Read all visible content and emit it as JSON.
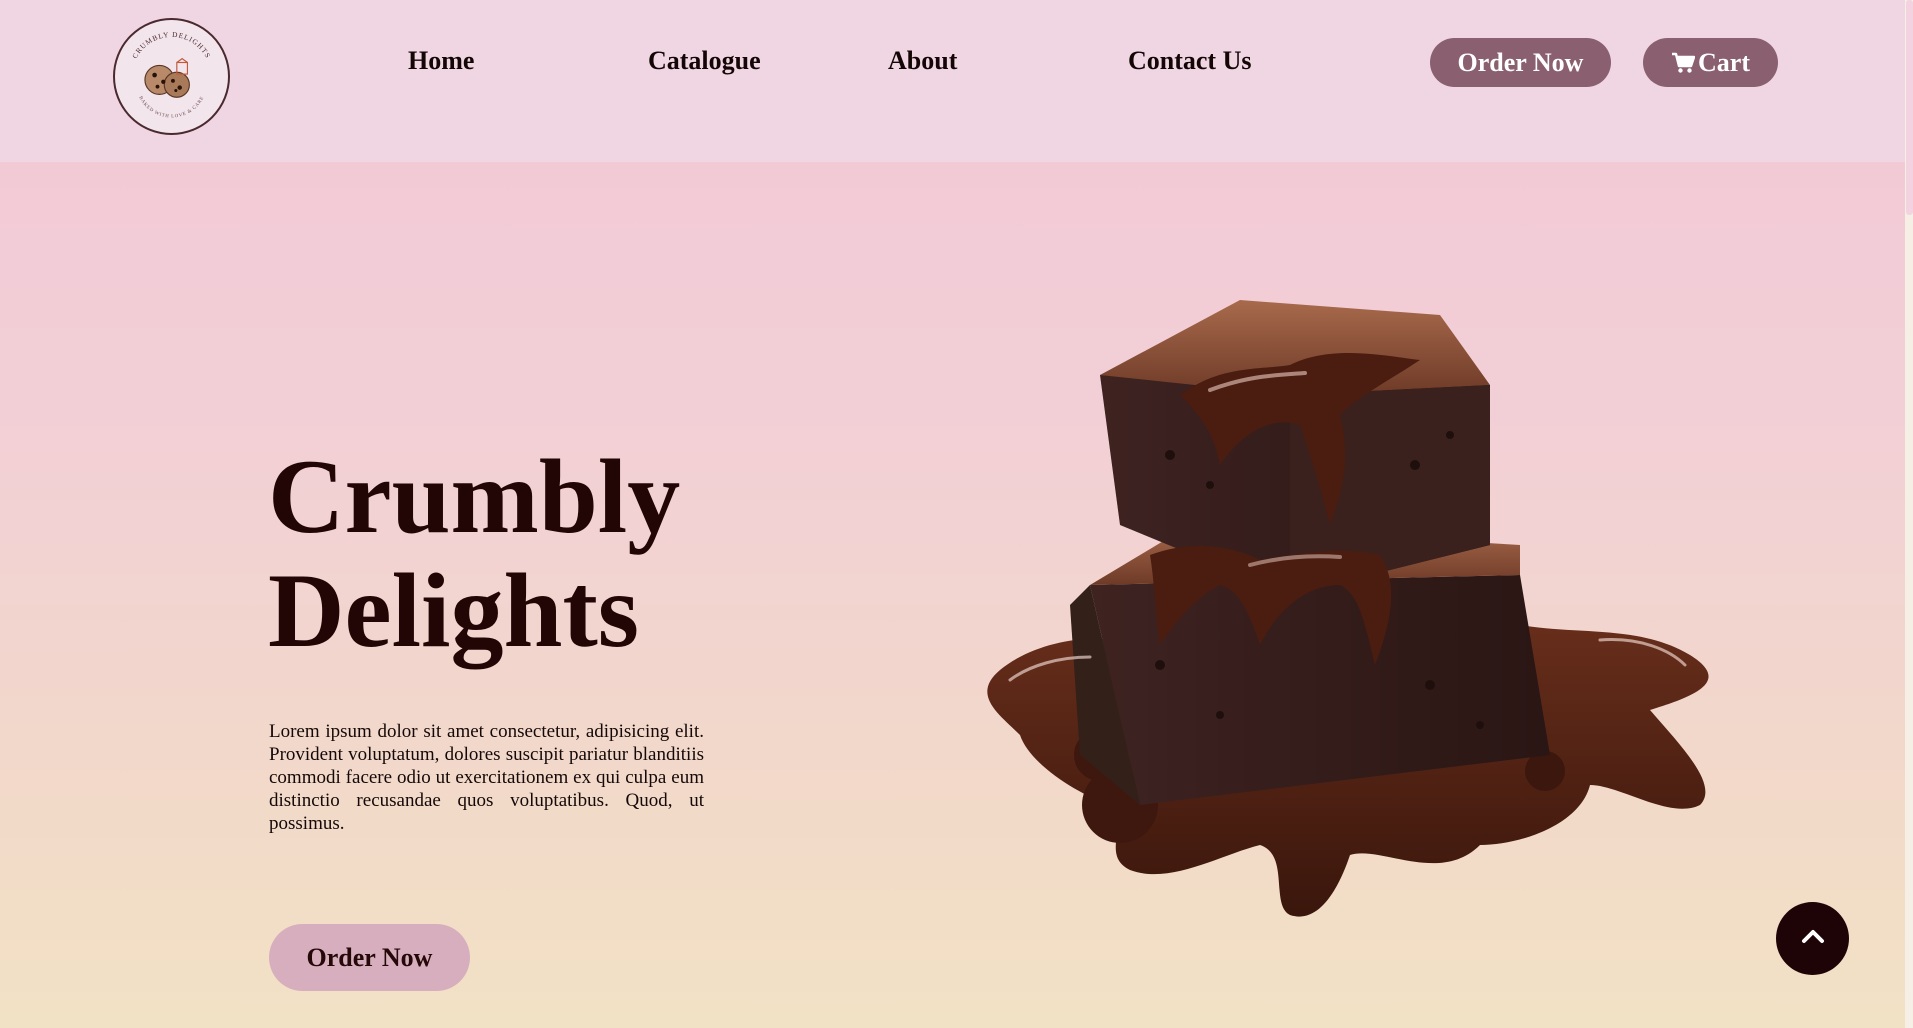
{
  "nav": {
    "logo_text": "CRUMBLY DELIGHTS",
    "logo_tagline": "BAKED WITH LOVE & CARE",
    "links": [
      "Home",
      "Catalogue",
      "About",
      "Contact Us"
    ],
    "order_button": "Order Now",
    "cart_button": "Cart"
  },
  "hero": {
    "title_line1": "Crumbly",
    "title_line2": "Delights",
    "description": "Lorem ipsum dolor sit amet consectetur, adipisicing elit. Provident voluptatum, dolores suscipit pariatur blanditiis commodi facere odio ut exercitationem ex qui culpa eum distinctio recusandae quos voluptatibus. Quod, ut possimus.",
    "order_button": "Order Now"
  },
  "icons": {
    "cart": "cart-icon",
    "scroll_top": "chevron-up-icon",
    "logo_graphic": "cookie-icon"
  },
  "colors": {
    "nav_bg": "#efd6e2",
    "nav_button": "#8a5f6f",
    "hero_button": "#d7aebe",
    "title": "#220606",
    "scroll_top_button": "#1e0407"
  }
}
